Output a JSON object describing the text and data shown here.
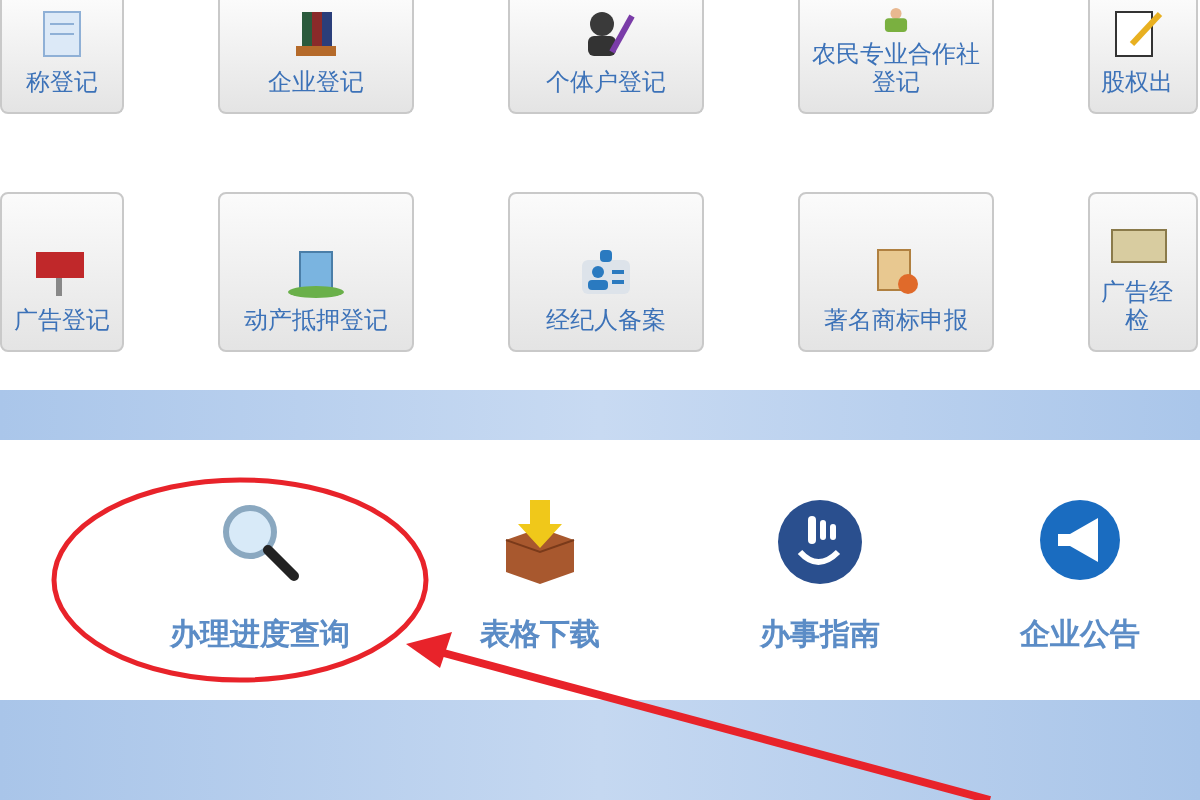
{
  "tile_rows": [
    [
      {
        "label": "称登记"
      },
      {
        "label": "企业登记"
      },
      {
        "label": "个体户登记"
      },
      {
        "label": "农民专业合作社登记"
      },
      {
        "label": "股权出"
      }
    ],
    [
      {
        "label": "广告登记"
      },
      {
        "label": "动产抵押登记"
      },
      {
        "label": "经纪人备案"
      },
      {
        "label": "著名商标申报"
      },
      {
        "label": "广告经检"
      }
    ]
  ],
  "quick_links": [
    {
      "label": "办理进度查询",
      "circled": true
    },
    {
      "label": "表格下载",
      "circled": false
    },
    {
      "label": "办事指南",
      "circled": false
    },
    {
      "label": "企业公告",
      "circled": false
    }
  ]
}
